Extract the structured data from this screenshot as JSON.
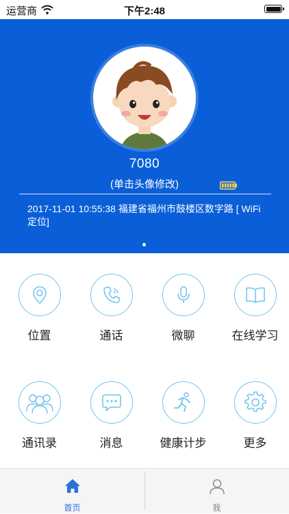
{
  "status_bar": {
    "carrier": "运营商",
    "time": "下午2:48",
    "wifi_icon": "wifi-icon",
    "battery_icon": "battery-icon"
  },
  "profile": {
    "device_id": "7080",
    "avatar_hint": "(单击头像修改)",
    "location": "2017-11-01 10:55:38 福建省福州市鼓楼区数字路 [ WiFi定位]",
    "avatar_icon": "boy-avatar",
    "device_battery_icon": "battery-icon",
    "carousel_pages": 1,
    "carousel_active": 1
  },
  "grid": {
    "items": [
      {
        "label": "位置",
        "icon": "location-pin-icon"
      },
      {
        "label": "通话",
        "icon": "phone-icon"
      },
      {
        "label": "微聊",
        "icon": "microphone-icon"
      },
      {
        "label": "在线学习",
        "icon": "book-icon"
      },
      {
        "label": "通讯录",
        "icon": "contacts-icon"
      },
      {
        "label": "消息",
        "icon": "chat-bubble-icon"
      },
      {
        "label": "健康计步",
        "icon": "running-icon"
      },
      {
        "label": "更多",
        "icon": "gear-icon"
      }
    ]
  },
  "tab_bar": {
    "tabs": [
      {
        "label": "首页",
        "icon": "home-icon",
        "active": true
      },
      {
        "label": "我",
        "icon": "user-icon",
        "active": false
      }
    ]
  },
  "colors": {
    "header_bg": "#0a5fd8",
    "icon_outline": "#6cc4ec",
    "tab_active": "#2a72d8",
    "tab_inactive": "#888888"
  }
}
